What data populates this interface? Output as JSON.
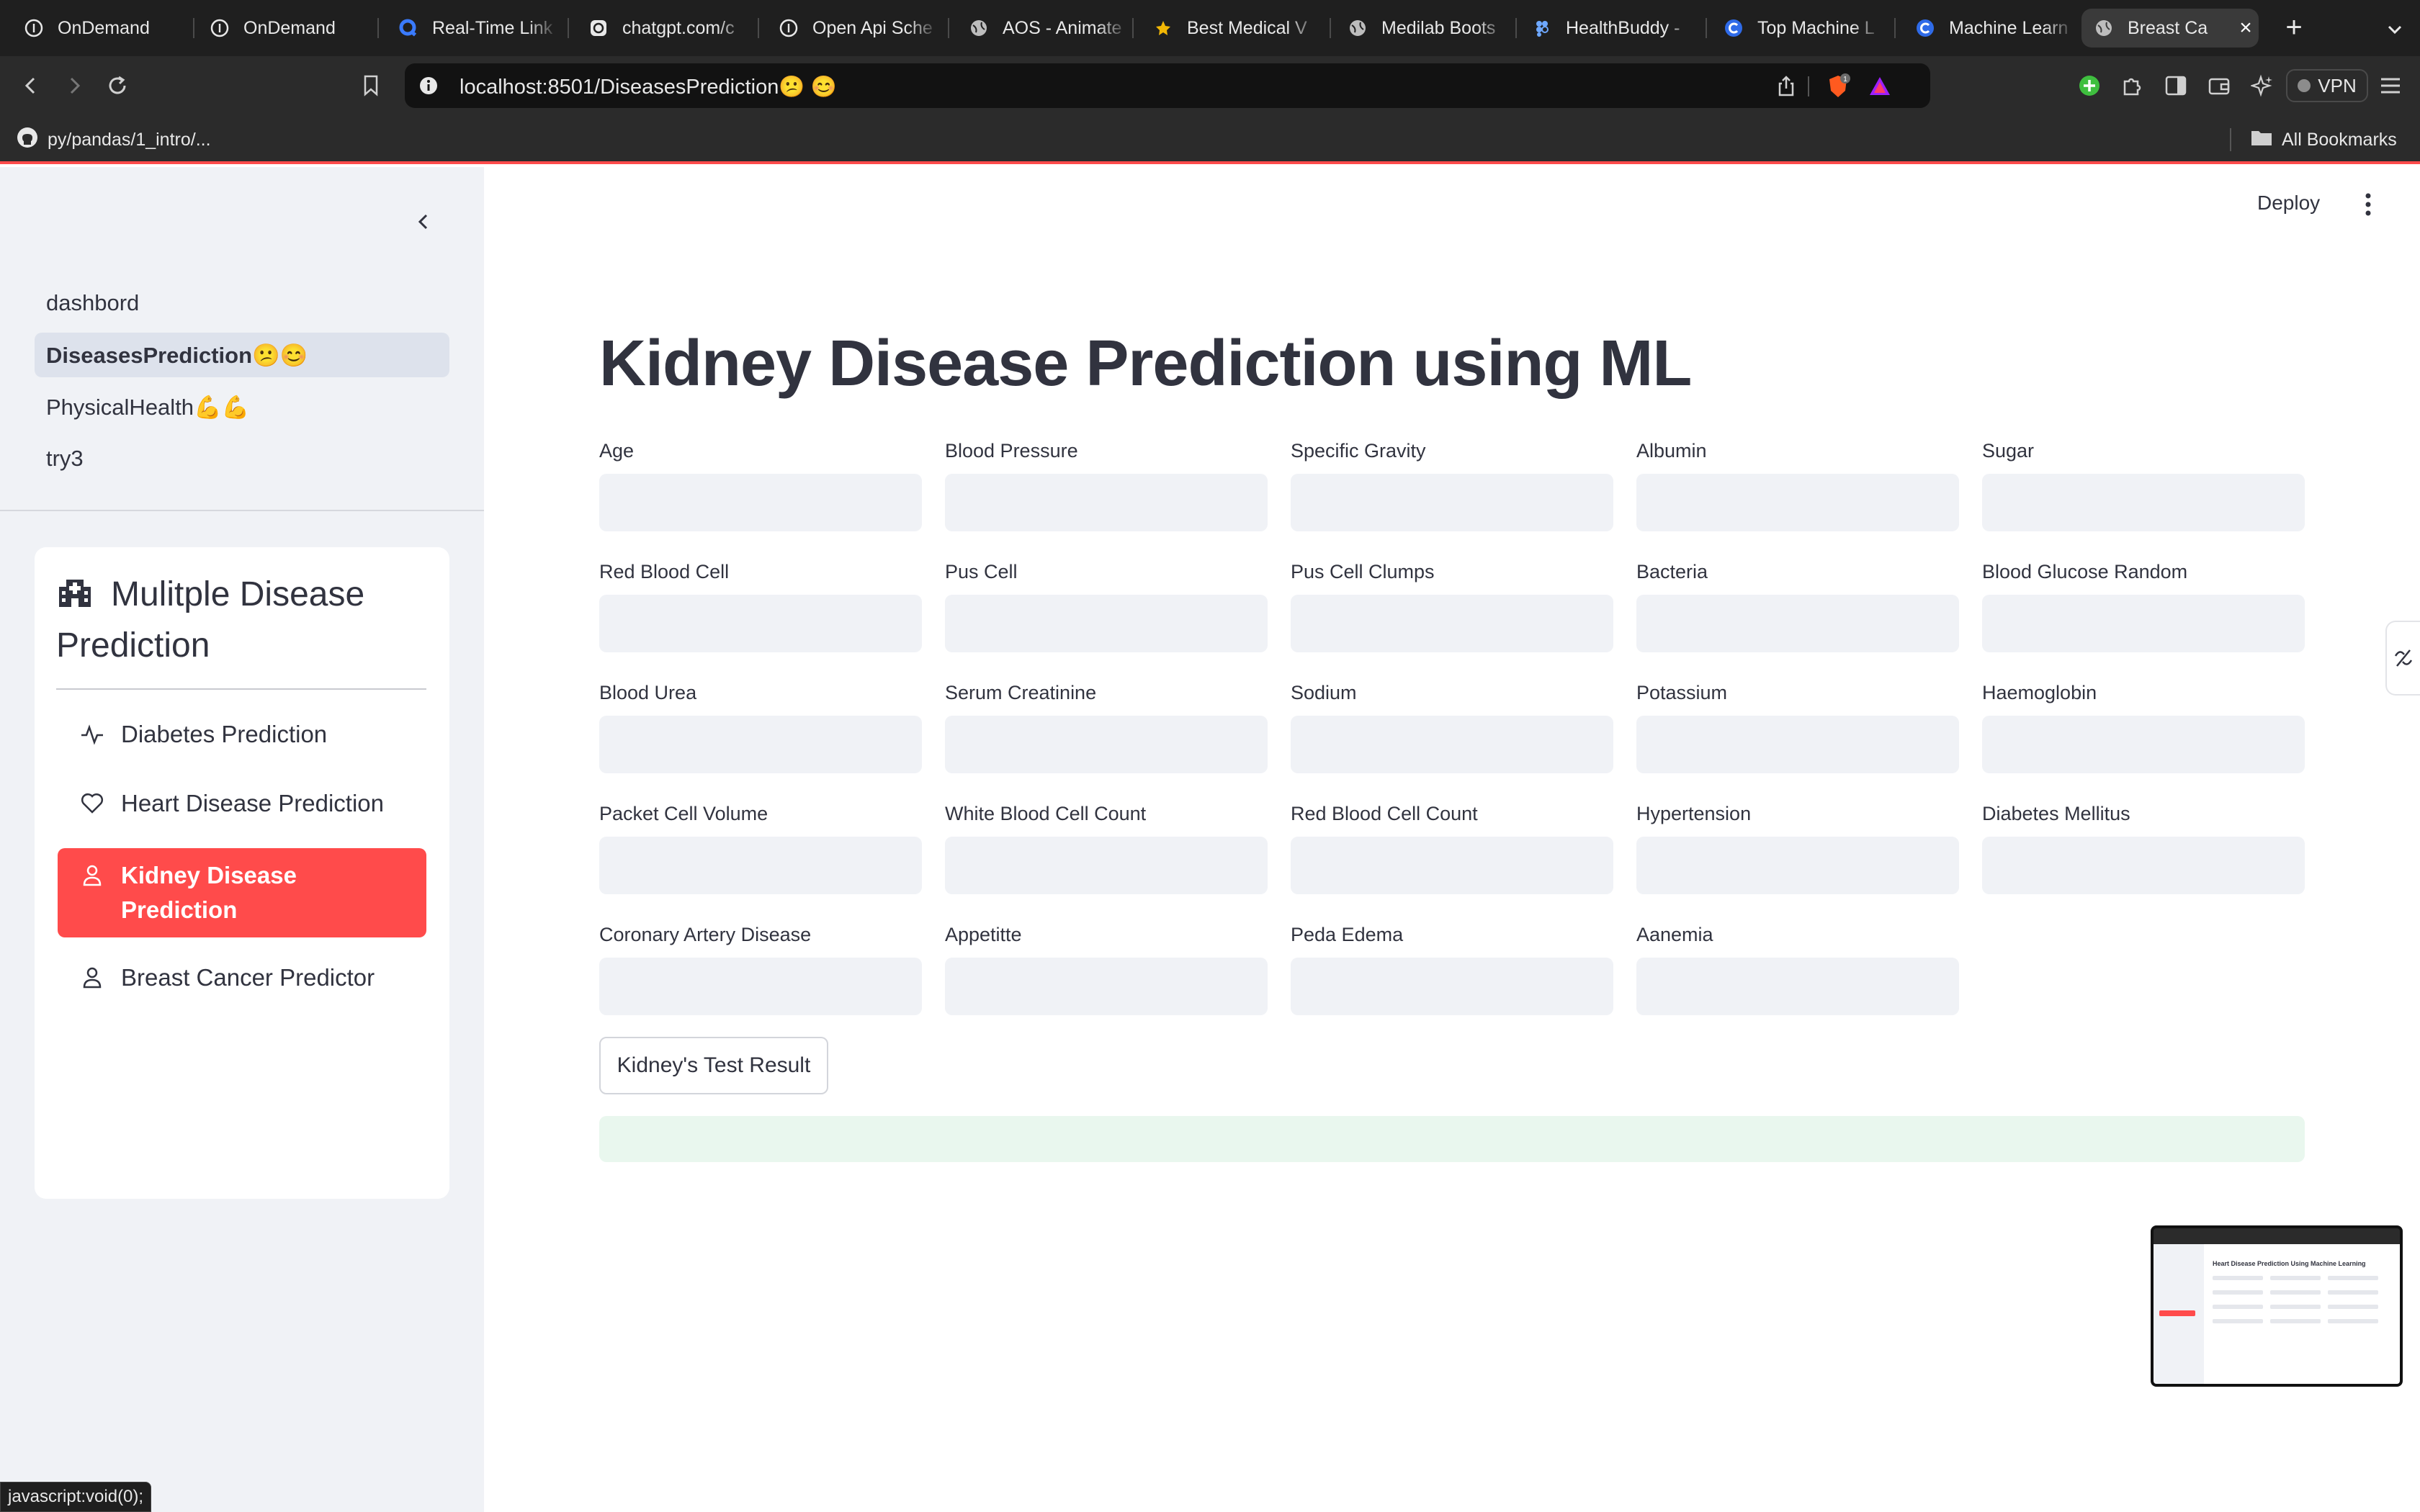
{
  "browser": {
    "tabs": [
      {
        "title": "OnDemand",
        "icon": "circle-info-icon"
      },
      {
        "title": "OnDemand",
        "icon": "circle-info-icon"
      },
      {
        "title": "Real-Time Link",
        "icon": "q-logo-icon"
      },
      {
        "title": "chatgpt.com/c",
        "icon": "chatgpt-icon"
      },
      {
        "title": "Open Api Sche",
        "icon": "circle-info-icon"
      },
      {
        "title": "AOS - Animate",
        "icon": "globe-icon"
      },
      {
        "title": "Best Medical V",
        "icon": "star-logo-icon"
      },
      {
        "title": "Medilab Boots",
        "icon": "globe-icon"
      },
      {
        "title": "HealthBuddy -",
        "icon": "figma-icon"
      },
      {
        "title": "Top Machine L",
        "icon": "c-logo-icon"
      },
      {
        "title": "Machine Learn",
        "icon": "c-logo-icon"
      },
      {
        "title": "Breast Ca",
        "icon": "globe-icon"
      }
    ],
    "url_host": "localhost",
    "url_rest": ":8501/DiseasesPrediction😕 😊",
    "brave_badge": "1",
    "vpn_label": "VPN",
    "bookmark": "py/pandas/1_intro/...",
    "all_bookmarks": "All Bookmarks"
  },
  "sidebar": {
    "pages": [
      {
        "label": "dashbord"
      },
      {
        "label": "DiseasesPrediction😕😊"
      },
      {
        "label": "PhysicalHealth💪💪"
      },
      {
        "label": "try3"
      }
    ],
    "menu_title": "Mulitple Disease Prediction",
    "menu_items": [
      {
        "label": "Diabetes Prediction",
        "icon": "activity-icon"
      },
      {
        "label": "Heart Disease Prediction",
        "icon": "heart-icon"
      },
      {
        "label": "Kidney Disease Prediction",
        "icon": "person-icon"
      },
      {
        "label": "Breast Cancer Predictor",
        "icon": "person-icon"
      }
    ]
  },
  "header": {
    "deploy": "Deploy"
  },
  "main": {
    "title": "Kidney Disease Prediction using ML",
    "fields": [
      "Age",
      "Blood Pressure",
      "Specific Gravity",
      "Albumin",
      "Sugar",
      "Red Blood Cell",
      "Pus Cell",
      "Pus Cell Clumps",
      "Bacteria",
      "Blood Glucose Random",
      "Blood Urea",
      "Serum Creatinine",
      "Sodium",
      "Potassium",
      "Haemoglobin",
      "Packet Cell Volume",
      "White Blood Cell Count",
      "Red Blood Cell Count",
      "Hypertension",
      "Diabetes Mellitus",
      "Coronary Artery Disease",
      "Appetitte",
      "Peda Edema",
      "Aanemia"
    ],
    "submit_label": "Kidney's Test Result"
  },
  "thumbnail": {
    "title": "Heart Disease Prediction Using Machine Learning"
  },
  "status_bar": "javascript:void(0);",
  "colors": {
    "accent": "#ff4b4b",
    "sidebar_bg": "#f0f2f6",
    "text": "#31333f",
    "success_bg": "#e9f7ee"
  }
}
